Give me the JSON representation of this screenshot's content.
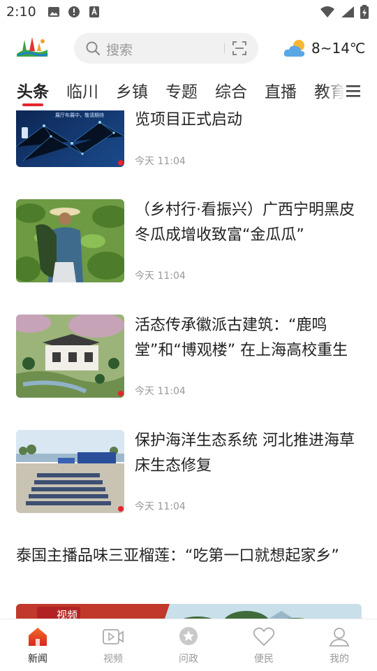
{
  "status_bar": {
    "time": "2:10",
    "icons": [
      "image-icon",
      "alert-icon",
      "text-box-icon",
      "wifi-icon",
      "signal-icon",
      "battery-charging-icon"
    ]
  },
  "header": {
    "logo": "app-logo",
    "search_placeholder": "搜索",
    "weather": {
      "icon": "partly-cloudy-icon",
      "temp": "8~14℃"
    }
  },
  "tabs": [
    {
      "label": "头条",
      "active": true
    },
    {
      "label": "临川"
    },
    {
      "label": "乡镇"
    },
    {
      "label": "专题"
    },
    {
      "label": "综合"
    },
    {
      "label": "直播"
    },
    {
      "label": "教育"
    }
  ],
  "news": [
    {
      "title_tail": "览项目正式启动",
      "time": "今天 11:04",
      "thumb_caption": "展厅布展中，敬请期待"
    },
    {
      "title": "（乡村行·看振兴）广西宁明黑皮冬瓜成增收致富“金瓜瓜”",
      "time": "今天 11:04"
    },
    {
      "title": "活态传承徽派古建筑：“鹿鸣堂”和“博观楼” 在上海高校重生",
      "time": "今天 11:04"
    },
    {
      "title": "保护海洋生态系统 河北推进海草床生态修复",
      "time": "今天 11:04"
    },
    {
      "title": "泰国主播品味三亚榴莲：“吃第一口就想起家乡”",
      "badge": "视频"
    }
  ],
  "bottom_nav": [
    {
      "label": "新闻",
      "icon": "home-icon",
      "active": true
    },
    {
      "label": "视频",
      "icon": "video-icon"
    },
    {
      "label": "问政",
      "icon": "star-bubble-icon"
    },
    {
      "label": "便民",
      "icon": "heart-icon"
    },
    {
      "label": "我的",
      "icon": "user-icon"
    }
  ],
  "colors": {
    "accent": "#e2262b",
    "text": "#222222",
    "muted": "#999999"
  }
}
